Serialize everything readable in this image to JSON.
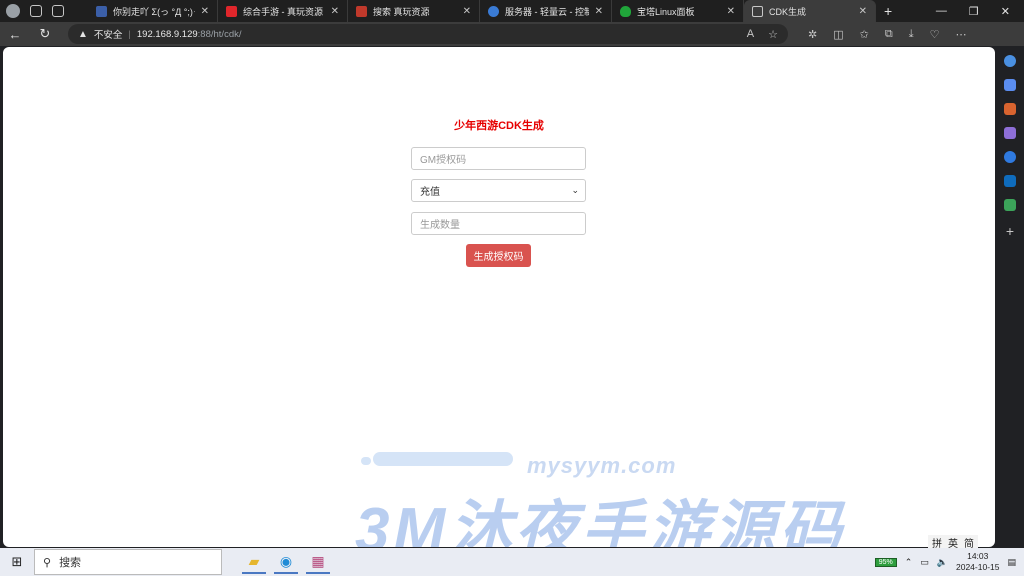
{
  "browser": {
    "tabs": [
      {
        "title": "你别走吖 Σ(っ °Д °;)っ",
        "color": "#3b5fa8"
      },
      {
        "title": "综合手游 - 真玩资源",
        "color": "#e0262b"
      },
      {
        "title": "搜索 真玩资源",
        "color": "#c0392b"
      },
      {
        "title": "服务器 - 轻量云 - 控制台",
        "color": "#3a7bd5"
      },
      {
        "title": "宝塔Linux面板",
        "color": "#20a53a"
      },
      {
        "title": "CDK生成",
        "color": "#9aa0a6"
      }
    ],
    "address": {
      "security": "不安全",
      "host": "192.168.9.129",
      "path": ":88/ht/cdk/"
    }
  },
  "page": {
    "title": "少年西游CDK生成",
    "gm_placeholder": "GM授权码",
    "select_value": "充值",
    "quantity_placeholder": "生成数量",
    "generate_label": "生成授权码"
  },
  "watermark": {
    "url": "mysyym.com",
    "text": "3M沐夜手游源码"
  },
  "taskbar": {
    "search_label": "搜索",
    "battery": "95%",
    "time": "14:03",
    "date": "2024-10-15",
    "ime_1": "拼",
    "ime_2": "英",
    "ime_3": "简"
  }
}
